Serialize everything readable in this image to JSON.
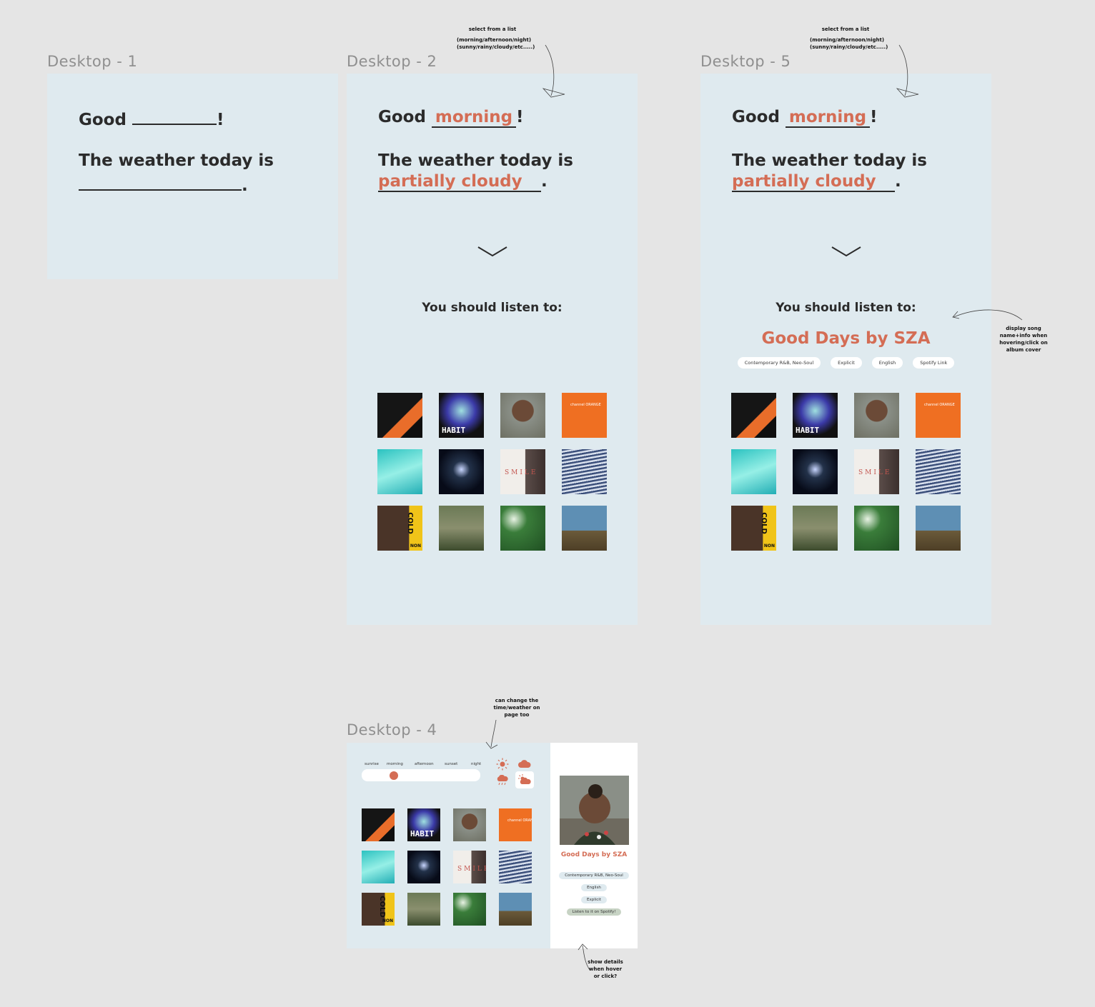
{
  "frames": {
    "d1": {
      "label": "Desktop - 1",
      "good": "Good",
      "excl": "!",
      "weather_prefix": "The weather today is",
      "period": "."
    },
    "d2": {
      "label": "Desktop - 2",
      "good": "Good",
      "time_value": "morning",
      "excl": "!",
      "weather_prefix": "The weather today is",
      "weather_value": "partially cloudy",
      "period": ".",
      "listen_title": "You should listen to:"
    },
    "d5": {
      "label": "Desktop - 5",
      "good": "Good",
      "time_value": "morning",
      "excl": "!",
      "weather_prefix": "The weather today is",
      "weather_value": "partially cloudy",
      "period": ".",
      "listen_title": "You should listen to:",
      "song_title": "Good Days by SZA",
      "chips": [
        "Contemporary R&B, Neo-Soul",
        "Explicit",
        "English",
        "Spotify Link"
      ]
    },
    "d4": {
      "label": "Desktop - 4",
      "time_labels": [
        "sunrise",
        "morning",
        "afternoon",
        "sunset",
        "night"
      ],
      "slider_position": 0.27,
      "weather_icons": [
        "sun-icon",
        "cloud-icon",
        "rain-cloud-icon",
        "partly-cloudy-icon"
      ],
      "selected_weather": "partly-cloudy-icon",
      "song_title": "Good Days by SZA",
      "chips": [
        "Contemporary R&B, Neo-Soul",
        "English",
        "Explicit"
      ],
      "spotify_button": "Listen to it on Spotify!"
    }
  },
  "notes": {
    "n1_title": "select from a list",
    "n1_line1": "(morning/afternoon/night)",
    "n1_line2": "(sunny/rainy/cloudy/etc.....)",
    "n2_title": "select from a list",
    "n2_line1": "(morning/afternoon/night)",
    "n2_line2": "(sunny/rainy/cloudy/etc.....)",
    "n3_line1": "display song",
    "n3_line2": "name+info when",
    "n3_line3": "hovering/click on",
    "n3_line4": "album cover",
    "n4_line1": "can change the",
    "n4_line2": "time/weather on",
    "n4_line3": "page too",
    "n5_line1": "show details",
    "n5_line2": "when hover",
    "n5_line3": "or click?"
  },
  "album_covers": {
    "habit": "HABIT",
    "channel_orange": "channel ORANGE",
    "smile": "SMILE",
    "cold": "COLD",
    "non": "NON"
  },
  "colors": {
    "background": "#e5e5e5",
    "frame": "#dfeaef",
    "accent": "#d46d55",
    "text": "#2b2b2b",
    "label": "#8f8f8f"
  }
}
